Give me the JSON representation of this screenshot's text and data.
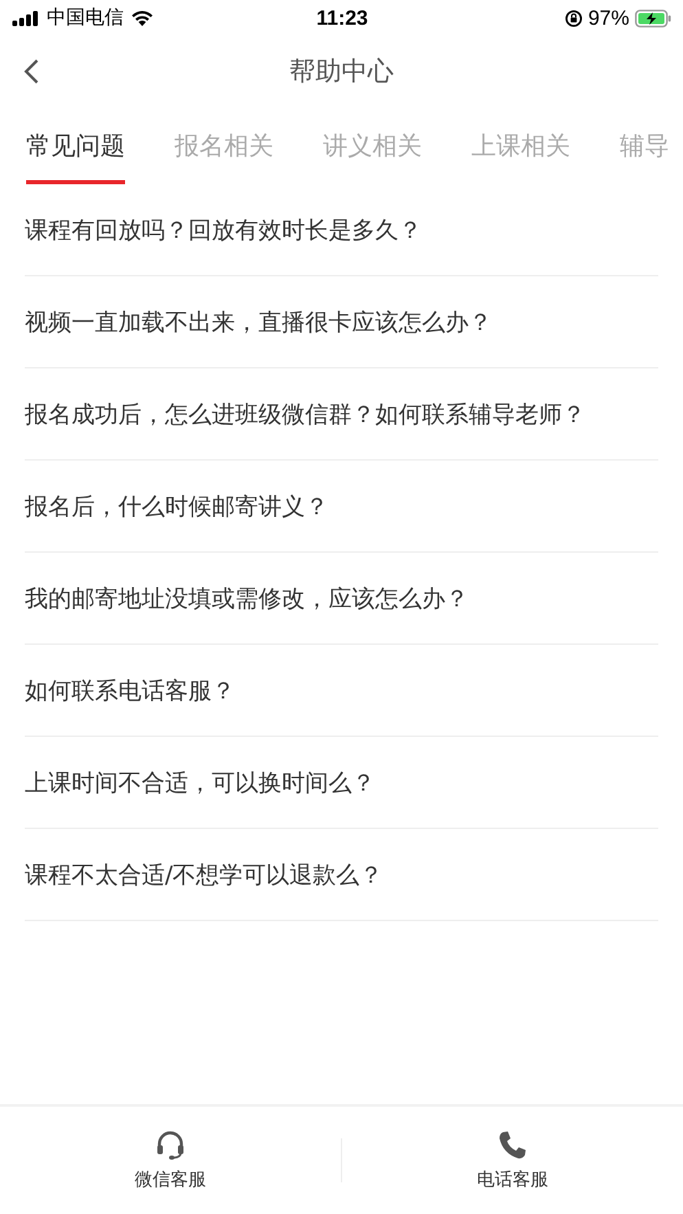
{
  "status_bar": {
    "carrier": "中国电信",
    "time": "11:23",
    "battery": "97%"
  },
  "nav": {
    "title": "帮助中心"
  },
  "tabs": [
    {
      "label": "常见问题",
      "selected": true
    },
    {
      "label": "报名相关",
      "selected": false
    },
    {
      "label": "讲义相关",
      "selected": false
    },
    {
      "label": "上课相关",
      "selected": false
    },
    {
      "label": "辅导",
      "selected": false
    }
  ],
  "questions": [
    "课程有回放吗？回放有效时长是多久？",
    "视频一直加载不出来，直播很卡应该怎么办？",
    "报名成功后，怎么进班级微信群？如何联系辅导老师？",
    "报名后，什么时候邮寄讲义？",
    "我的邮寄地址没填或需修改，应该怎么办？",
    "如何联系电话客服？",
    "上课时间不合适，可以换时间么？",
    "课程不太合适/不想学可以退款么？"
  ],
  "bottom_bar": [
    {
      "kind": "headset",
      "label": "微信客服"
    },
    {
      "kind": "phone",
      "label": "电话客服"
    }
  ]
}
